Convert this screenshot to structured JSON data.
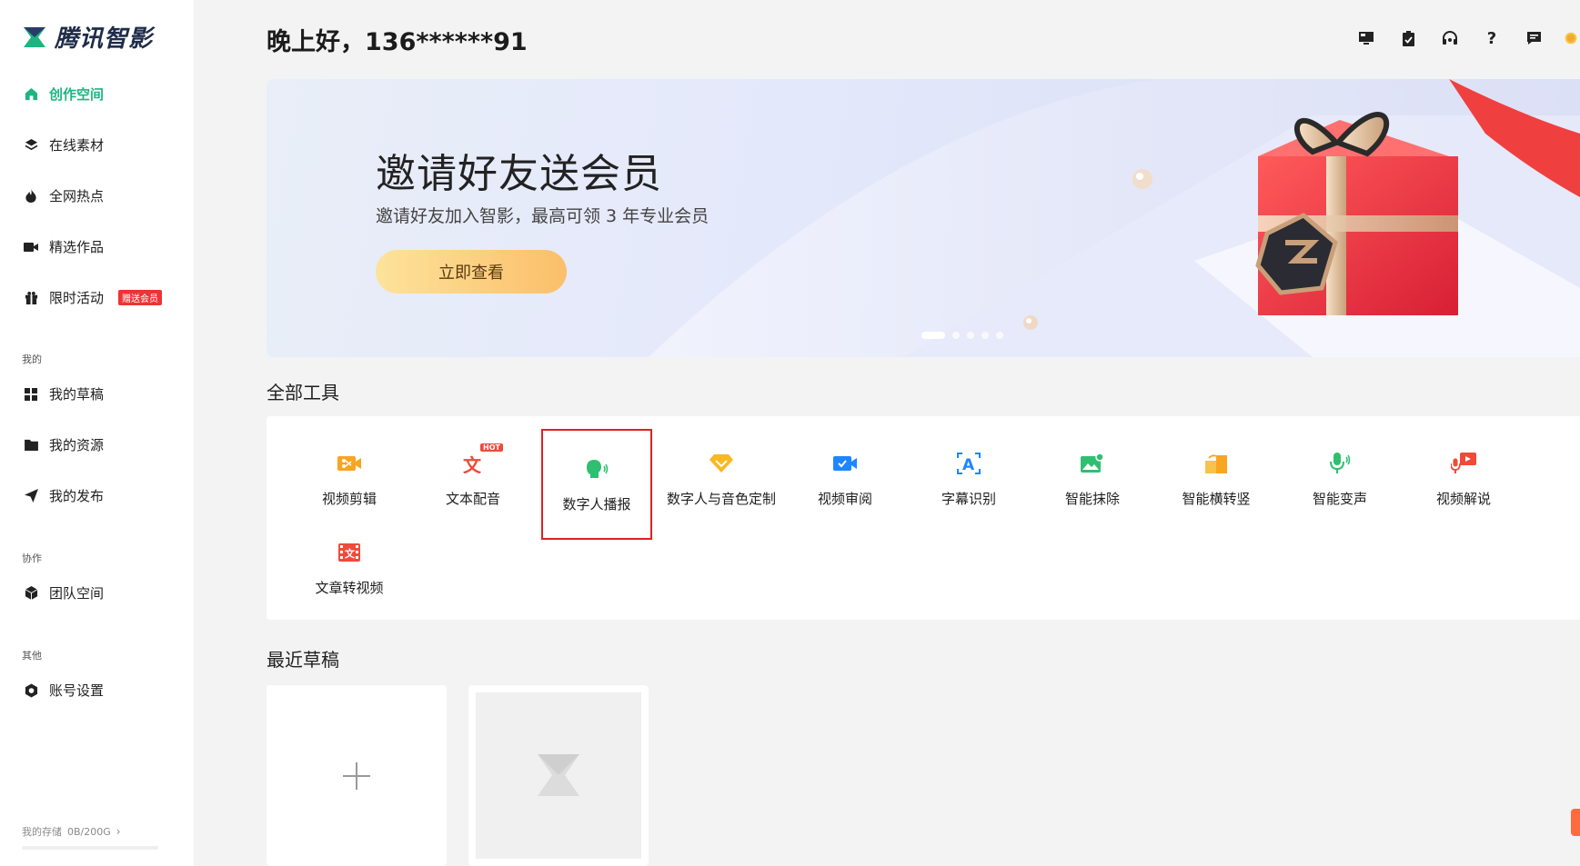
{
  "brand": {
    "name": "腾讯智影",
    "accent": "#1bb680"
  },
  "nav": {
    "items": [
      {
        "label": "创作空间",
        "icon": "home-icon",
        "active": true
      },
      {
        "label": "在线素材",
        "icon": "layers-icon"
      },
      {
        "label": "全网热点",
        "icon": "flame-icon"
      },
      {
        "label": "精选作品",
        "icon": "video-camera-icon"
      },
      {
        "label": "限时活动",
        "icon": "gift-icon",
        "badge": "赠送会员"
      }
    ],
    "section_mine": "我的",
    "mine": [
      {
        "label": "我的草稿",
        "icon": "grid-icon"
      },
      {
        "label": "我的资源",
        "icon": "folder-icon"
      },
      {
        "label": "我的发布",
        "icon": "send-icon"
      }
    ],
    "section_collab": "协作",
    "collab": [
      {
        "label": "团队空间",
        "icon": "cube-icon"
      }
    ],
    "section_other": "其他",
    "other": [
      {
        "label": "账号设置",
        "icon": "settings-hex-icon"
      }
    ],
    "storage_label": "我的存储",
    "storage_value": "0B/200G",
    "storage_fraction": 0
  },
  "header": {
    "greeting": "晚上好，136******91",
    "icons": [
      "monitor-icon",
      "clipboard-check-icon",
      "headset-icon",
      "help-icon",
      "message-icon",
      "coin-icon"
    ]
  },
  "banner": {
    "title": "邀请好友送会员",
    "subtitle": "邀请好友加入智影，最高可领 3 年专业会员",
    "button": "立即查看",
    "slide_count": 5,
    "active_slide": 0
  },
  "tools": {
    "heading": "全部工具",
    "items": [
      {
        "label": "视频剪辑",
        "icon": "scissors-camera-icon",
        "color": "#f8a521"
      },
      {
        "label": "文本配音",
        "icon": "text-voice-icon",
        "color": "#ef4a3a",
        "badge": "HOT"
      },
      {
        "label": "数字人播报",
        "icon": "speaking-head-icon",
        "color": "#2fbf71",
        "selected": true
      },
      {
        "label": "数字人与音色定制",
        "icon": "diamond-icon",
        "color": "#f8b81f"
      },
      {
        "label": "视频审阅",
        "icon": "video-check-icon",
        "color": "#1e86ff"
      },
      {
        "label": "字幕识别",
        "icon": "caption-a-icon",
        "color": "#1e86ff"
      },
      {
        "label": "智能抹除",
        "icon": "image-erase-icon",
        "color": "#2fbf71"
      },
      {
        "label": "智能横转竖",
        "icon": "rotate-frame-icon",
        "color": "#f8a521"
      },
      {
        "label": "智能变声",
        "icon": "microphone-icon",
        "color": "#2fbf71"
      },
      {
        "label": "视频解说",
        "icon": "mic-video-icon",
        "color": "#ef4a3a"
      },
      {
        "label": "文章转视频",
        "icon": "article-video-icon",
        "color": "#ef4a3a"
      }
    ]
  },
  "drafts": {
    "heading": "最近草稿",
    "new_label": "+"
  }
}
